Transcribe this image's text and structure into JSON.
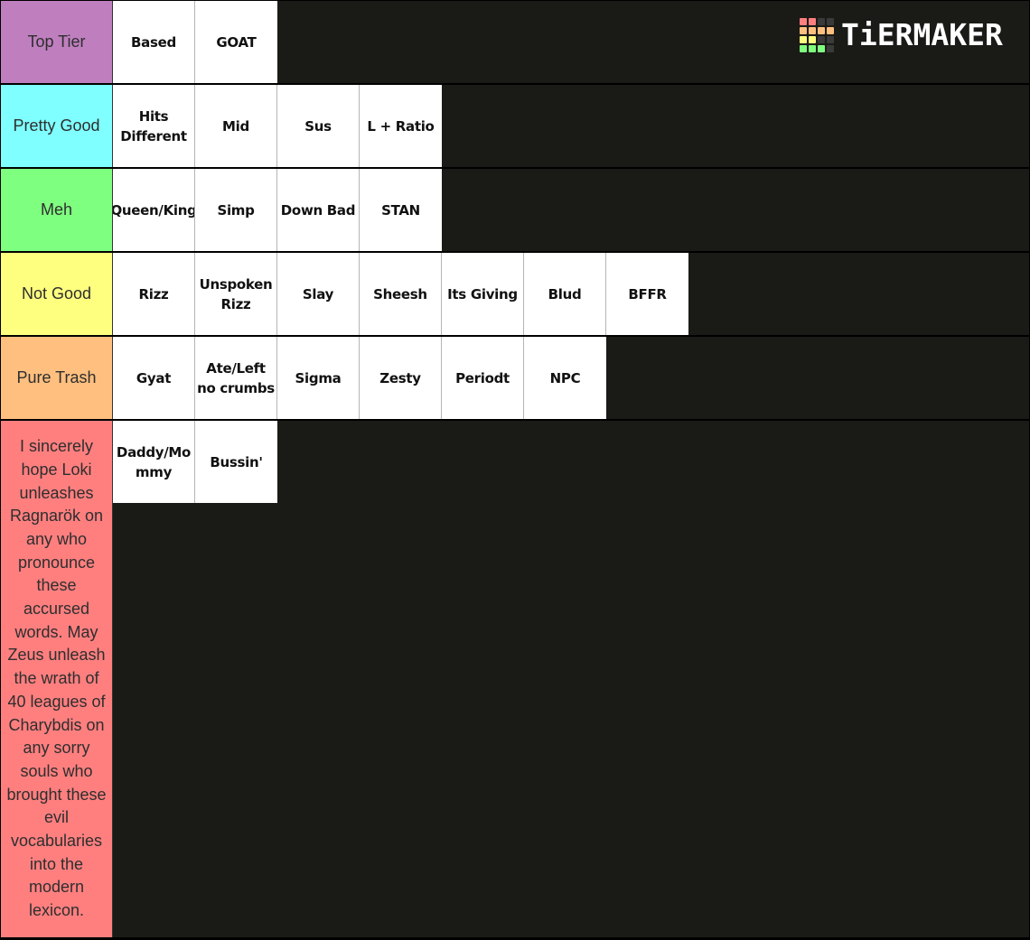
{
  "brand": {
    "name": "TiERMAKER",
    "grid_colors": [
      "#ff7f7f",
      "#ff7f7f",
      "#3a3a3a",
      "#3a3a3a",
      "#ffbf7f",
      "#ffbf7f",
      "#ffbf7f",
      "#ffbf7f",
      "#ffff7f",
      "#ffff7f",
      "#3a3a3a",
      "#3a3a3a",
      "#7fff7f",
      "#7fff7f",
      "#7fff7f",
      "#3a3a3a"
    ]
  },
  "tiers": [
    {
      "label": "Top Tier",
      "color": "#bf7fbf",
      "items": [
        "Based",
        "GOAT"
      ]
    },
    {
      "label": "Pretty Good",
      "color": "#7fffff",
      "items": [
        "Hits Different",
        "Mid",
        "Sus",
        "L + Ratio"
      ]
    },
    {
      "label": "Meh",
      "color": "#7fff7f",
      "items": [
        "Queen/King",
        "Simp",
        "Down Bad",
        "STAN"
      ]
    },
    {
      "label": "Not Good",
      "color": "#ffff7f",
      "items": [
        "Rizz",
        "Unspoken Rizz",
        "Slay",
        "Sheesh",
        "Its Giving",
        "Blud",
        "BFFR"
      ]
    },
    {
      "label": "Pure Trash",
      "color": "#ffbf7f",
      "items": [
        "Gyat",
        "Ate/Left no crumbs",
        "Sigma",
        "Zesty",
        "Periodt",
        "NPC"
      ]
    },
    {
      "label": "I sincerely hope Loki unleashes Ragnarök on any who pronounce these accursed words. May Zeus unleash the wrath of 40 leagues of Charybdis on any sorry souls who brought these evil vocabularies into the modern lexicon.",
      "color": "#ff7f7f",
      "items": [
        "Daddy/Mommy",
        "Bussin'"
      ]
    }
  ]
}
